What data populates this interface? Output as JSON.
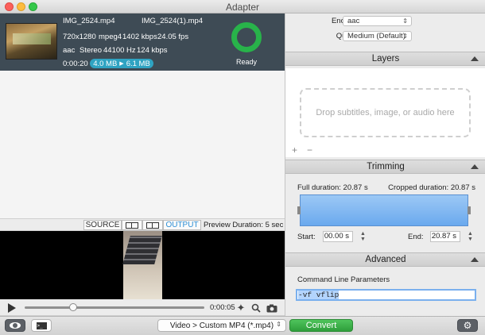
{
  "window": {
    "title": "Adapter"
  },
  "file": {
    "source_name": "IMG_2524.mp4",
    "output_name": "IMG_2524(1).mp4",
    "resolution": "720x1280",
    "video_codec": "mpeg4",
    "video_bitrate": "1402 kbps",
    "fps": "24.05 fps",
    "audio_codec": "aac",
    "channels": "Stereo",
    "sample_rate": "44100 Hz",
    "audio_bitrate": "124 kbps",
    "duration": "0:00:20",
    "size_from": "4.0 MB",
    "size_to": "6.1 MB",
    "status": "Ready"
  },
  "view_toggle": {
    "source_label": "SOURCE",
    "output_label": "OUTPUT",
    "preview_duration_label": "Preview Duration:",
    "preview_duration_value": "5 sec"
  },
  "player": {
    "time": "0:00:05",
    "progress": 0.27
  },
  "settings": {
    "encoder_label": "Encoder:",
    "encoder_value": "aac",
    "quality_label": "Quality:",
    "quality_value": "Medium (Default)"
  },
  "layers": {
    "title": "Layers",
    "drop_text": "Drop subtitles, image, or audio here",
    "add_label": "+",
    "remove_label": "−"
  },
  "trimming": {
    "title": "Trimming",
    "full_duration": "Full duration: 20.87 s",
    "cropped_duration": "Cropped duration: 20.87 s",
    "start_label": "Start:",
    "start_value": "00.00 s",
    "end_label": "End:",
    "end_value": "20.87 s"
  },
  "advanced": {
    "title": "Advanced",
    "cmd_label": "Command Line Parameters",
    "cmd_value": "-vf vflip"
  },
  "bottom": {
    "preset": "Video > Custom MP4 (*.mp4)",
    "convert_label": "Convert"
  },
  "colors": {
    "file_row_bg": "#3e4b55",
    "ready_ring": "#28b34a",
    "size_badge": "#2fa3c2",
    "convert_green": "#34a845",
    "output_blue": "#2f8fd5"
  },
  "icons": {
    "eye": "eye-icon",
    "terminal": "terminal-icon",
    "gear": "gear-icon",
    "play": "play-icon",
    "magic": "magic-wand-icon",
    "zoom": "magnifier-icon",
    "camera": "camera-icon"
  }
}
